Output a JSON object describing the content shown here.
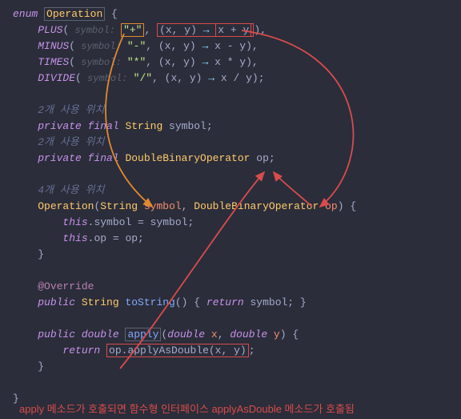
{
  "code": {
    "l1a": "enum",
    "l1b": "Operation",
    "l1c": " {",
    "l2a": "PLUS",
    "l2b": "(",
    "l2hint1": " symbol: ",
    "l2str": "\"+\"",
    "l2c": ", ",
    "l2d": "(x, y)",
    "l2arr": " → ",
    "l2e": "x + y",
    "l2f": "),",
    "l3a": "MINUS",
    "l3b": "(",
    "l3hint1": " symbol: ",
    "l3str": "\"-\"",
    "l3c": ", ",
    "l3d": "(x, y)",
    "l3arr": " → ",
    "l3e": "x - y",
    "l3f": "),",
    "l4a": "TIMES",
    "l4b": "(",
    "l4hint1": " symbol: ",
    "l4str": "\"*\"",
    "l4c": ", ",
    "l4d": "(x, y)",
    "l4arr": " → ",
    "l4e": "x * y",
    "l4f": "),",
    "l5a": "DIVIDE",
    "l5b": "(",
    "l5hint1": " symbol: ",
    "l5str": "\"/\"",
    "l5c": ", ",
    "l5d": "(x, y)",
    "l5arr": " → ",
    "l5e": "x / y",
    "l5f": ");",
    "l7": "2개 사용 위치",
    "l8a": "private",
    "l8b": " final ",
    "l8c": "String",
    "l8d": " symbol;",
    "l9": "2개 사용 위치",
    "l10a": "private",
    "l10b": " final ",
    "l10c": "DoubleBinaryOperator",
    "l10d": " op;",
    "l12": "4개 사용 위치",
    "l13a": "Operation",
    "l13b": "(",
    "l13c": "String",
    "l13d": " symbol",
    "l13e": ", ",
    "l13f": "DoubleBinaryOperator",
    "l13g": " op",
    "l13h": ") {",
    "l14a": "this",
    "l14b": ".symbol = symbol;",
    "l15a": "this",
    "l15b": ".op = op;",
    "l16": "}",
    "l18": "@Override",
    "l19a": "public",
    "l19b": " String ",
    "l19c": "toString",
    "l19d": "() { ",
    "l19e": "return",
    "l19f": " symbol; }",
    "l21a": "public",
    "l21b": " double ",
    "l21c": "apply",
    "l21d": "(",
    "l21e": "double",
    "l21f": " x",
    "l21g": ", ",
    "l21h": "double",
    "l21i": " y",
    "l21j": ") {",
    "l22a": "return",
    "l22b": " ",
    "l22c": "op.applyAsDouble(x, y)",
    "l22d": ";",
    "l23": "}",
    "l24": "}"
  },
  "footnote": "apply 메소드가 호출되면 함수형 인터페이스 applyAsDouble 메소드가 호출됨"
}
